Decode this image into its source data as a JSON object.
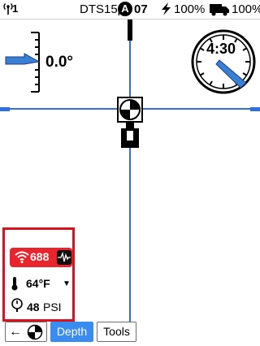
{
  "status_bar": {
    "signal_icon": "antenna-signal-icon",
    "signal_count": "1",
    "device_name": "DTS15p",
    "mode_badge": "A",
    "channel": "07",
    "locator_battery_icon": "battery-bolt-icon",
    "locator_battery": "100%",
    "truck_icon": "truck-battery-icon",
    "truck_battery": "100%"
  },
  "roll_gauge": {
    "value": "0.0°",
    "icon": "roll-pointer-icon"
  },
  "clock_gauge": {
    "value": "4:30",
    "icon": "clock-dial-icon"
  },
  "crosshair": {
    "icon": "target-marker-icon"
  },
  "info_box": {
    "depth_icon": "signal-wave-icon",
    "depth_value": "688",
    "waveform_icon": "waveform-icon",
    "temp_icon": "thermometer-icon",
    "temp_value": "64°F",
    "temp_caret": "▼",
    "pressure_icon": "pressure-gauge-icon",
    "pressure_value": "48",
    "pressure_unit": "PSI",
    "highlight_color": "#d6141f"
  },
  "toolbar": {
    "back_arrow": "←",
    "back_icon": "target-icon",
    "depth_label": "Depth",
    "tools_label": "Tools",
    "active_color": "#3a8cf0"
  },
  "colors": {
    "axis_blue": "#2f6fe0",
    "pointer_blue": "#3b7fd4"
  }
}
